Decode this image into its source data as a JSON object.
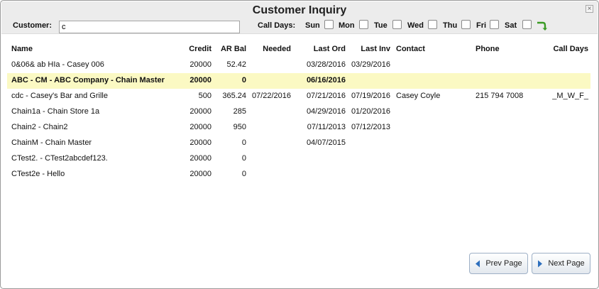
{
  "dialog": {
    "title": "Customer Inquiry",
    "close_glyph": "×"
  },
  "filters": {
    "customer_label": "Customer:",
    "customer_value": "c",
    "call_days_label": "Call Days:",
    "days": [
      "Sun",
      "Mon",
      "Tue",
      "Wed",
      "Thu",
      "Fri",
      "Sat"
    ]
  },
  "table": {
    "columns": {
      "name": "Name",
      "credit": "Credit",
      "ar_bal": "AR Bal",
      "needed": "Needed",
      "last_ord": "Last Ord",
      "last_inv": "Last Inv",
      "contact": "Contact",
      "phone": "Phone",
      "call_days": "Call Days"
    },
    "rows": [
      {
        "name": "0&06& ab HIa - Casey 006",
        "credit": "20000",
        "ar_bal": "52.42",
        "needed": "",
        "last_ord": "03/28/2016",
        "last_inv": "03/29/2016",
        "contact": "",
        "phone": "",
        "call_days": ""
      },
      {
        "name": "ABC - CM - ABC Company - Chain Master",
        "credit": "20000",
        "ar_bal": "0",
        "needed": "",
        "last_ord": "06/16/2016",
        "last_inv": "",
        "contact": "",
        "phone": "",
        "call_days": ""
      },
      {
        "name": "cdc - Casey's Bar and Grille",
        "credit": "500",
        "ar_bal": "365.24",
        "needed": "07/22/2016",
        "last_ord": "07/21/2016",
        "last_inv": "07/19/2016",
        "contact": "Casey Coyle",
        "phone": "215 794 7008",
        "call_days": "_M_W_F_"
      },
      {
        "name": "Chain1a - Chain Store 1a",
        "credit": "20000",
        "ar_bal": "285",
        "needed": "",
        "last_ord": "04/29/2016",
        "last_inv": "01/20/2016",
        "contact": "",
        "phone": "",
        "call_days": ""
      },
      {
        "name": "Chain2 - Chain2",
        "credit": "20000",
        "ar_bal": "950",
        "needed": "",
        "last_ord": "07/11/2013",
        "last_inv": "07/12/2013",
        "contact": "",
        "phone": "",
        "call_days": ""
      },
      {
        "name": "ChainM - Chain Master",
        "credit": "20000",
        "ar_bal": "0",
        "needed": "",
        "last_ord": "04/07/2015",
        "last_inv": "",
        "contact": "",
        "phone": "",
        "call_days": ""
      },
      {
        "name": "CTest2. - CTest2abcdef123.",
        "credit": "20000",
        "ar_bal": "0",
        "needed": "",
        "last_ord": "",
        "last_inv": "",
        "contact": "",
        "phone": "",
        "call_days": ""
      },
      {
        "name": "CTest2e - Hello",
        "credit": "20000",
        "ar_bal": "0",
        "needed": "",
        "last_ord": "",
        "last_inv": "",
        "contact": "",
        "phone": "",
        "call_days": ""
      }
    ],
    "selected_row": 1
  },
  "pagination": {
    "prev_label": "Prev Page",
    "next_label": "Next Page"
  },
  "icons": {
    "close": "close-icon",
    "go": "green-return-arrow-icon",
    "prev": "triangle-left-icon",
    "next": "triangle-right-icon"
  },
  "colors": {
    "selected_row": "#fbf9c3",
    "go_arrow": "#3a9a24",
    "page_arrow": "#2e6fbd"
  }
}
